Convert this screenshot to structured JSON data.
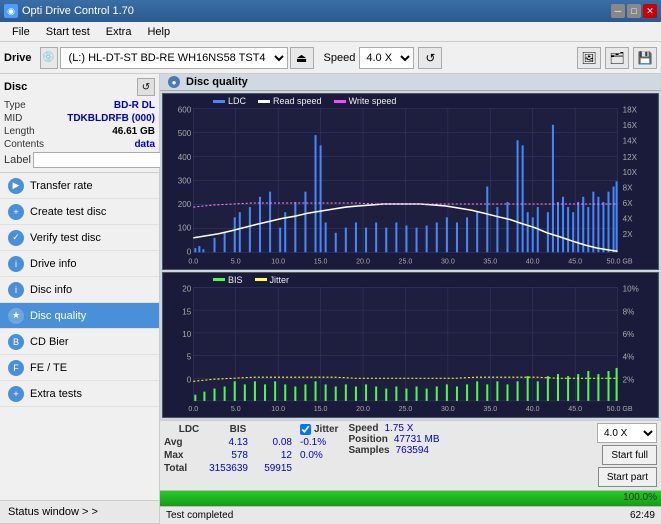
{
  "titlebar": {
    "title": "Opti Drive Control 1.70",
    "icon": "●",
    "min_btn": "─",
    "max_btn": "□",
    "close_btn": "✕"
  },
  "menubar": {
    "items": [
      "File",
      "Start test",
      "Extra",
      "Help"
    ]
  },
  "toolbar": {
    "drive_label": "Drive",
    "drive_value": "(L:)  HL-DT-ST BD-RE  WH16NS58 TST4",
    "speed_label": "Speed",
    "speed_value": "4.0 X"
  },
  "disc": {
    "title": "Disc",
    "type_label": "Type",
    "type_value": "BD-R DL",
    "mid_label": "MID",
    "mid_value": "TDKBLDRFB (000)",
    "length_label": "Length",
    "length_value": "46.61 GB",
    "contents_label": "Contents",
    "contents_value": "data",
    "label_label": "Label",
    "label_value": ""
  },
  "nav": {
    "items": [
      {
        "id": "transfer-rate",
        "label": "Transfer rate"
      },
      {
        "id": "create-test-disc",
        "label": "Create test disc"
      },
      {
        "id": "verify-test-disc",
        "label": "Verify test disc"
      },
      {
        "id": "drive-info",
        "label": "Drive info"
      },
      {
        "id": "disc-info",
        "label": "Disc info"
      },
      {
        "id": "disc-quality",
        "label": "Disc quality",
        "active": true
      },
      {
        "id": "cd-bier",
        "label": "CD Bier"
      },
      {
        "id": "fe-te",
        "label": "FE / TE"
      },
      {
        "id": "extra-tests",
        "label": "Extra tests"
      }
    ]
  },
  "status_window": {
    "label": "Status window > >"
  },
  "chart_header": {
    "title": "Disc quality",
    "icon": "●"
  },
  "chart1": {
    "title": "Disc quality",
    "legend": [
      {
        "label": "LDC",
        "color": "#4488ff"
      },
      {
        "label": "Read speed",
        "color": "#ffffff"
      },
      {
        "label": "Write speed",
        "color": "#ff44ff"
      }
    ],
    "y_max": 600,
    "y_right_labels": [
      "18X",
      "16X",
      "14X",
      "12X",
      "10X",
      "8X",
      "6X",
      "4X",
      "2X"
    ],
    "x_labels": [
      "0.0",
      "5.0",
      "10.0",
      "15.0",
      "20.0",
      "25.0",
      "30.0",
      "35.0",
      "40.0",
      "45.0",
      "50.0 GB"
    ]
  },
  "chart2": {
    "legend": [
      {
        "label": "BIS",
        "color": "#44ff44"
      },
      {
        "label": "Jitter",
        "color": "#ffff44"
      }
    ],
    "y_max": 20,
    "y_right_labels": [
      "10%",
      "8%",
      "6%",
      "4%",
      "2%"
    ],
    "x_labels": [
      "0.0",
      "5.0",
      "10.0",
      "15.0",
      "20.0",
      "25.0",
      "30.0",
      "35.0",
      "40.0",
      "45.0",
      "50.0 GB"
    ]
  },
  "stats": {
    "col_headers": [
      "LDC",
      "BIS",
      "",
      "Jitter",
      "Speed",
      "",
      ""
    ],
    "avg_label": "Avg",
    "avg_ldc": "4.13",
    "avg_bis": "0.08",
    "avg_jitter": "-0.1%",
    "max_label": "Max",
    "max_ldc": "578",
    "max_bis": "12",
    "max_jitter": "0.0%",
    "total_label": "Total",
    "total_ldc": "3153639",
    "total_bis": "59915",
    "jitter_checked": true,
    "speed_label": "Speed",
    "speed_value": "1.75 X",
    "position_label": "Position",
    "position_value": "47731 MB",
    "samples_label": "Samples",
    "samples_value": "763594",
    "speed_select": "4.0 X",
    "start_full_btn": "Start full",
    "start_part_btn": "Start part"
  },
  "progress": {
    "status_text": "Test completed",
    "percent": "100.0%",
    "fill_width": 100,
    "time": "62:49"
  }
}
